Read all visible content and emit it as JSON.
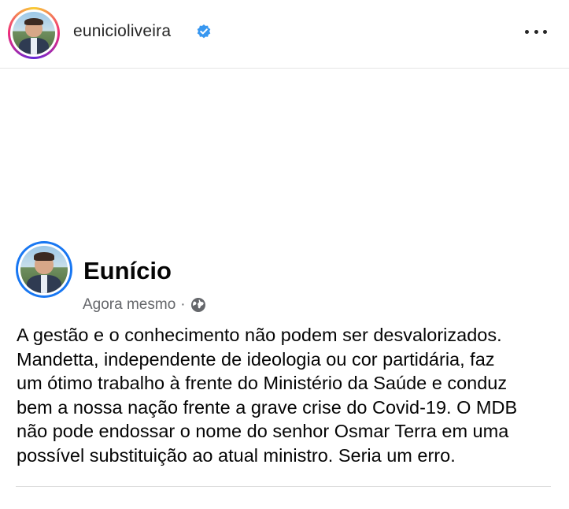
{
  "header": {
    "username": "eunicioliveira",
    "verified_color": "#3897f0",
    "more_icon": "more-horizontal-icon"
  },
  "post": {
    "author": "Eunício",
    "timestamp": "Agora mesmo",
    "separator": "·",
    "privacy_icon": "globe-icon",
    "text": "A gestão e o conhecimento não podem ser desvalorizados.\nMandetta, independente de ideologia ou cor partidária, faz\num ótimo trabalho à frente do Ministério da Saúde e conduz\nbem a nossa nação frente a grave crise do Covid-19. O MDB\nnão pode endossar o nome do senhor Osmar Terra em uma\npossível substituição ao atual ministro. Seria um erro."
  }
}
